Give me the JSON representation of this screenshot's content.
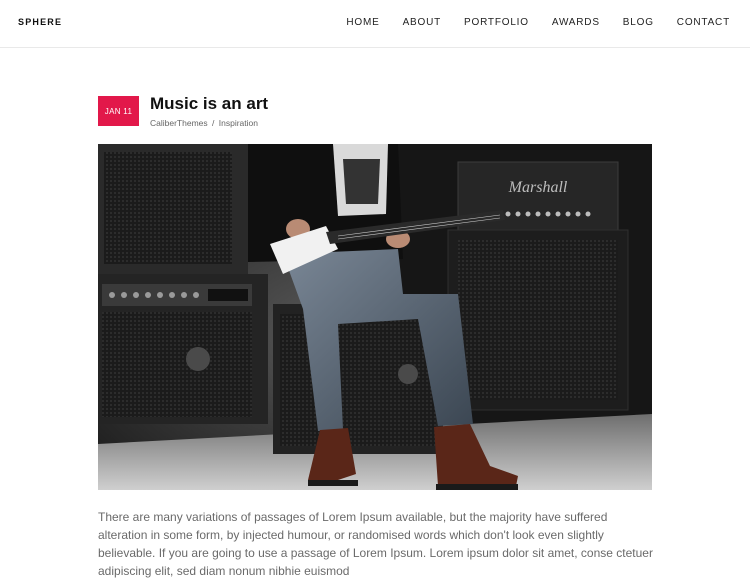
{
  "site": {
    "logo": "SPHERE"
  },
  "nav": {
    "items": [
      {
        "label": "HOME",
        "name": "nav-home"
      },
      {
        "label": "ABOUT",
        "name": "nav-about"
      },
      {
        "label": "PORTFOLIO",
        "name": "nav-portfolio"
      },
      {
        "label": "AWARDS",
        "name": "nav-awards"
      },
      {
        "label": "BLOG",
        "name": "nav-blog"
      },
      {
        "label": "CONTACT",
        "name": "nav-contact"
      }
    ]
  },
  "post": {
    "date": "JAN 11",
    "title": "Music is an art",
    "author": "CaliberThemes",
    "separator": "/",
    "category": "Inspiration",
    "image_text": "Marshall",
    "excerpt": "There are many variations of passages of Lorem Ipsum available, but the majority have suffered alteration in some form, by injected humour, or randomised words which don't look even slightly believable. If you are going to use a passage of Lorem Ipsum. Lorem ipsum dolor sit amet, conse ctetuer adipiscing elit, sed diam nonum nibhie euismod"
  },
  "colors": {
    "accent": "#e2184a"
  }
}
